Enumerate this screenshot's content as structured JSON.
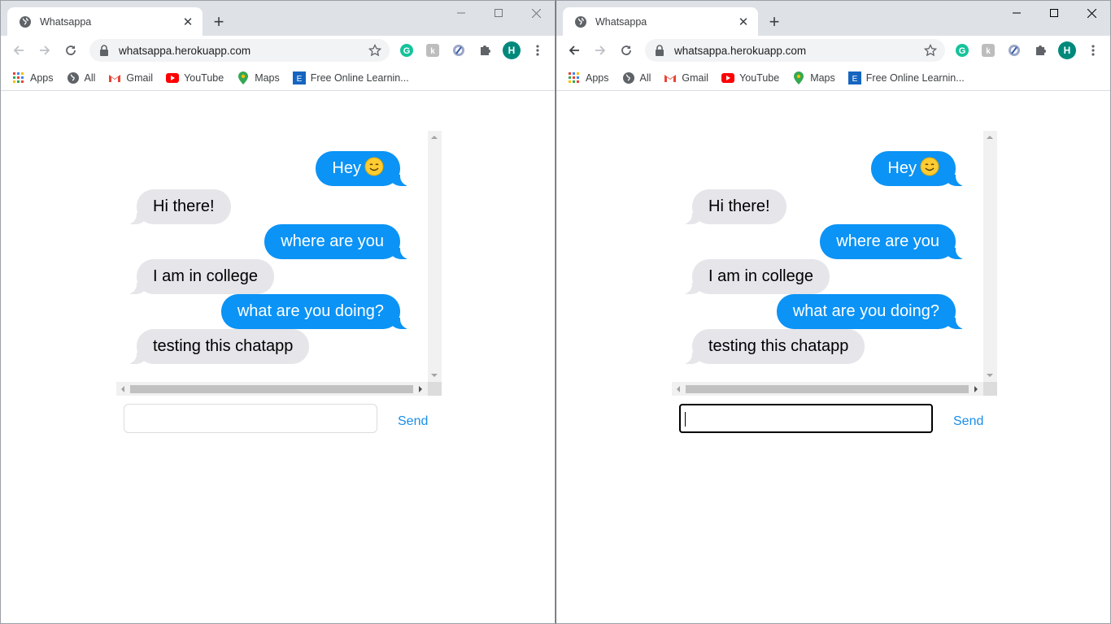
{
  "windows": [
    {
      "tab_title": "Whatsappa",
      "url": "whatsappa.herokuapp.com",
      "avatar_letter": "H",
      "bookmarks": [
        "Apps",
        "All",
        "Gmail",
        "YouTube",
        "Maps",
        "Free Online Learnin..."
      ],
      "messages": [
        {
          "side": "sent",
          "text": "Hey",
          "emoji": "smiling-face"
        },
        {
          "side": "recv",
          "text": "Hi there!"
        },
        {
          "side": "sent",
          "text": "where are you"
        },
        {
          "side": "recv",
          "text": "I am in college"
        },
        {
          "side": "sent",
          "text": "what are you doing?"
        },
        {
          "side": "recv",
          "text": "testing this chatapp"
        }
      ],
      "input_value": "",
      "input_focused": false,
      "send_label": "Send"
    },
    {
      "tab_title": "Whatsappa",
      "url": "whatsappa.herokuapp.com",
      "avatar_letter": "H",
      "bookmarks": [
        "Apps",
        "All",
        "Gmail",
        "YouTube",
        "Maps",
        "Free Online Learnin..."
      ],
      "messages": [
        {
          "side": "sent",
          "text": "Hey",
          "emoji": "smiling-face"
        },
        {
          "side": "recv",
          "text": "Hi there!"
        },
        {
          "side": "sent",
          "text": "where are you"
        },
        {
          "side": "recv",
          "text": "I am in college"
        },
        {
          "side": "sent",
          "text": "what are you doing?"
        },
        {
          "side": "recv",
          "text": "testing this chatapp"
        }
      ],
      "input_value": "",
      "input_focused": true,
      "send_label": "Send"
    }
  ],
  "colors": {
    "sent_bubble": "#0b93f6",
    "recv_bubble": "#e5e5ea",
    "send_link": "#1a8ee8"
  }
}
